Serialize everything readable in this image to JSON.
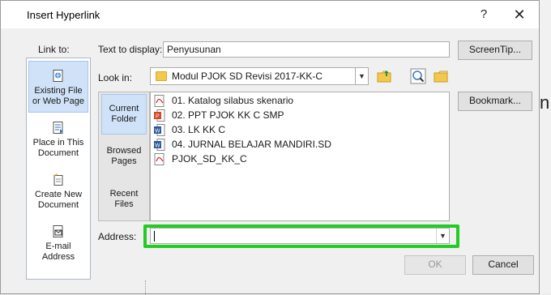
{
  "dialog": {
    "title": "Insert Hyperlink",
    "help_glyph": "?",
    "close_glyph": "✕"
  },
  "link_to": {
    "label": "Link to:",
    "items": [
      {
        "line1": "Existing File",
        "line2": "or Web Page",
        "icon": "existing-file-icon",
        "selected": true
      },
      {
        "line1": "Place in This",
        "line2": "Document",
        "icon": "place-in-document-icon",
        "selected": false
      },
      {
        "line1": "Create New",
        "line2": "Document",
        "icon": "new-document-icon",
        "selected": false
      },
      {
        "line1": "E-mail",
        "line2": "Address",
        "icon": "email-icon",
        "selected": false
      }
    ]
  },
  "text_to_display": {
    "label": "Text to display:",
    "value": "Penyusunan"
  },
  "look_in": {
    "label": "Look in:",
    "value": "Modul PJOK SD Revisi 2017-KK-C"
  },
  "side_panel": {
    "items": [
      {
        "line1": "Current",
        "line2": "Folder",
        "selected": true
      },
      {
        "line1": "Browsed",
        "line2": "Pages",
        "selected": false
      },
      {
        "line1": "Recent",
        "line2": "Files",
        "selected": false
      }
    ]
  },
  "files": [
    {
      "name": "01. Katalog silabus skenario",
      "icon": "pdf-file-icon"
    },
    {
      "name": "02. PPT PJOK KK C SMP",
      "icon": "powerpoint-file-icon"
    },
    {
      "name": "03. LK KK C",
      "icon": "word-file-icon"
    },
    {
      "name": "04. JURNAL BELAJAR MANDIRI.SD",
      "icon": "word-file-icon"
    },
    {
      "name": "PJOK_SD_KK_C",
      "icon": "pdf-file-icon"
    }
  ],
  "address": {
    "label": "Address:",
    "value": ""
  },
  "buttons": {
    "screentip": "ScreenTip...",
    "bookmark": "Bookmark...",
    "ok": "OK",
    "cancel": "Cancel"
  },
  "background_text": "n",
  "colors": {
    "highlight_border": "#22cc22",
    "selection_bg": "#cfe2f8"
  }
}
